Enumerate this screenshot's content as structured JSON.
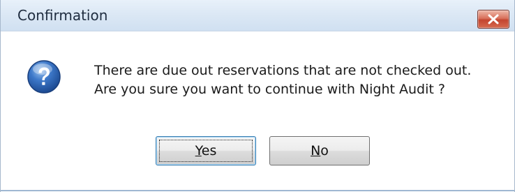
{
  "dialog": {
    "title": "Confirmation",
    "message_line1": "There are due out reservations that are not checked out.",
    "message_line2": "Are you sure you want to continue with Night Audit ?",
    "icon": "question-icon",
    "buttons": {
      "yes": {
        "mnemonic": "Y",
        "rest": "es"
      },
      "no": {
        "mnemonic": "N",
        "rest": "o"
      }
    },
    "colors": {
      "close_button": "#c4452f",
      "question_icon": "#2f67b9",
      "default_button_border": "#3c7fb1"
    }
  }
}
